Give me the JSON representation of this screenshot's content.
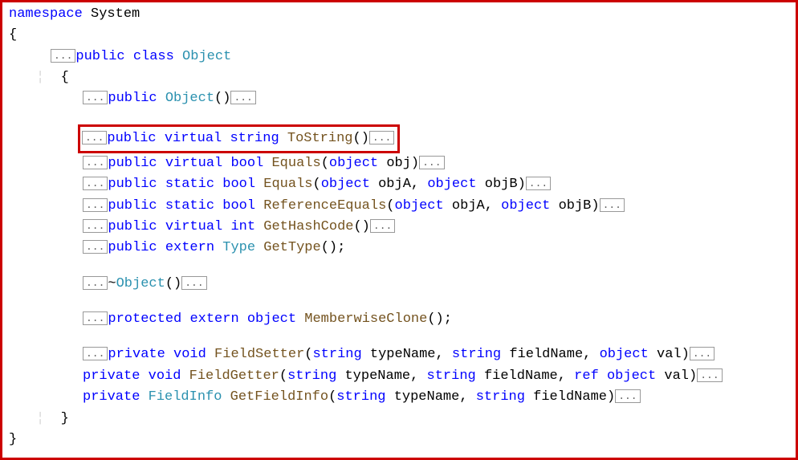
{
  "ellipsis": "...",
  "t": {
    "namespace": "namespace",
    "public": "public",
    "class": "class",
    "virtual": "virtual",
    "static": "static",
    "extern": "extern",
    "protected": "protected",
    "private": "private",
    "ref": "ref",
    "string": "string",
    "bool": "bool",
    "int": "int",
    "void": "void",
    "object_kw": "object",
    "System": "System",
    "Object": "Object",
    "Type": "Type",
    "FieldInfo": "FieldInfo",
    "ToString": "ToString",
    "Equals": "Equals",
    "ReferenceEquals": "ReferenceEquals",
    "GetHashCode": "GetHashCode",
    "GetType": "GetType",
    "MemberwiseClone": "MemberwiseClone",
    "FieldSetter": "FieldSetter",
    "FieldGetter": "FieldGetter",
    "GetFieldInfo": "GetFieldInfo",
    "obj": "obj",
    "objA": "objA",
    "objB": "objB",
    "typeName": "typeName",
    "fieldName": "fieldName",
    "val": "val"
  }
}
